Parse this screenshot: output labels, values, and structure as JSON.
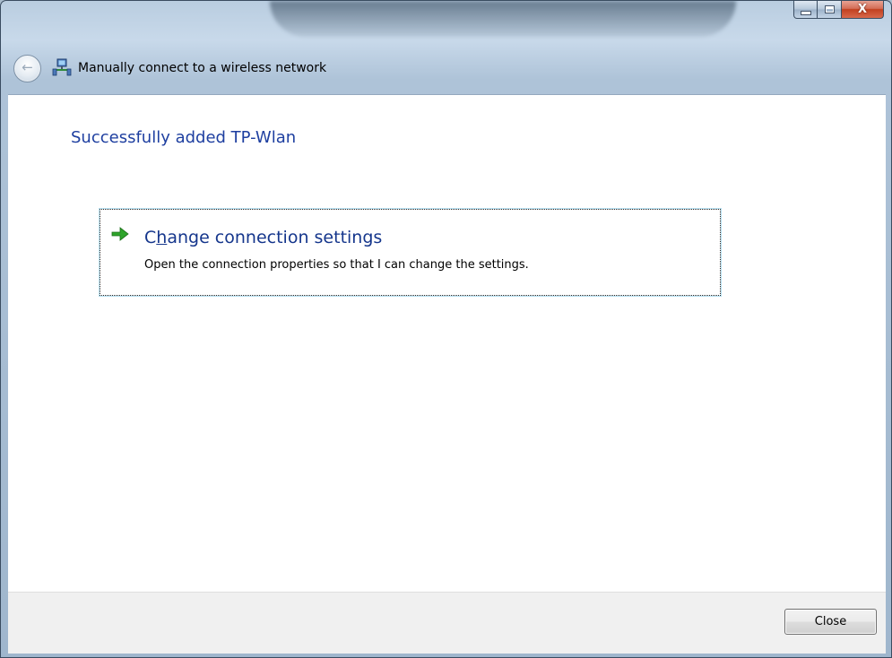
{
  "window": {
    "caption_buttons": {
      "minimize": "minimize-icon",
      "maximize": "maximize-icon",
      "close": "X"
    }
  },
  "nav": {
    "back_icon": "back-arrow-icon",
    "app_icon": "network-icon",
    "title": "Manually connect to a wireless network"
  },
  "content": {
    "heading": "Successfully added TP-Wlan",
    "command_link": {
      "icon": "green-arrow-icon",
      "title_pre": "C",
      "title_accel": "h",
      "title_post": "ange connection settings",
      "description": "Open the connection properties so that I can change the settings."
    }
  },
  "footer": {
    "close_label": "Close"
  },
  "colors": {
    "heading": "#1e3fa0",
    "link_title": "#15368c",
    "arrow": "#2ea42a",
    "close_button_red": "#c2401f"
  }
}
